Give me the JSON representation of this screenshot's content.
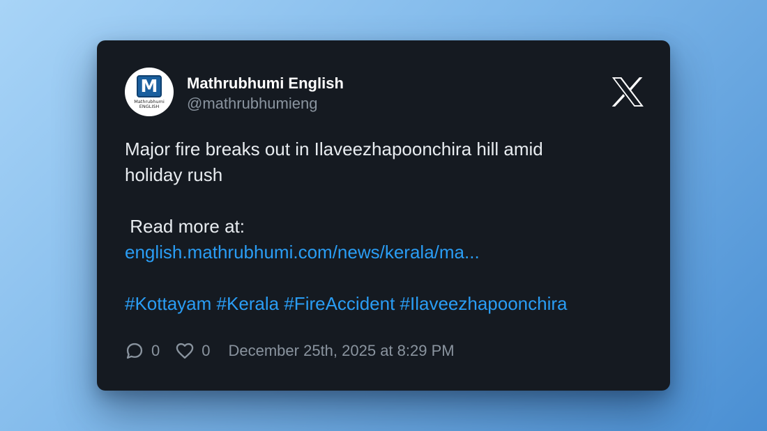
{
  "author": {
    "name": "Mathrubhumi English",
    "handle": "@mathrubhumieng",
    "avatar_letter": "M",
    "avatar_text_line1": "Mathrubhumi",
    "avatar_text_line2": "ENGLISH"
  },
  "post": {
    "line1": "Major fire breaks out in Ilaveezhapoonchira hill amid",
    "line2": "holiday rush",
    "read_more": " Read more at:",
    "link": "english.mathrubhumi.com/news/kerala/ma...",
    "hashtags": "#Kottayam #Kerala #FireAccident #Ilaveezhapoonchira"
  },
  "stats": {
    "replies": "0",
    "likes": "0",
    "timestamp": "December 25th, 2025 at 8:29 PM"
  },
  "icons": {
    "platform": "x-logo-icon",
    "reply": "comment-icon",
    "like": "heart-icon"
  },
  "colors": {
    "card_bg": "#151a21",
    "link": "#2a9df4",
    "muted": "#8a949f"
  }
}
